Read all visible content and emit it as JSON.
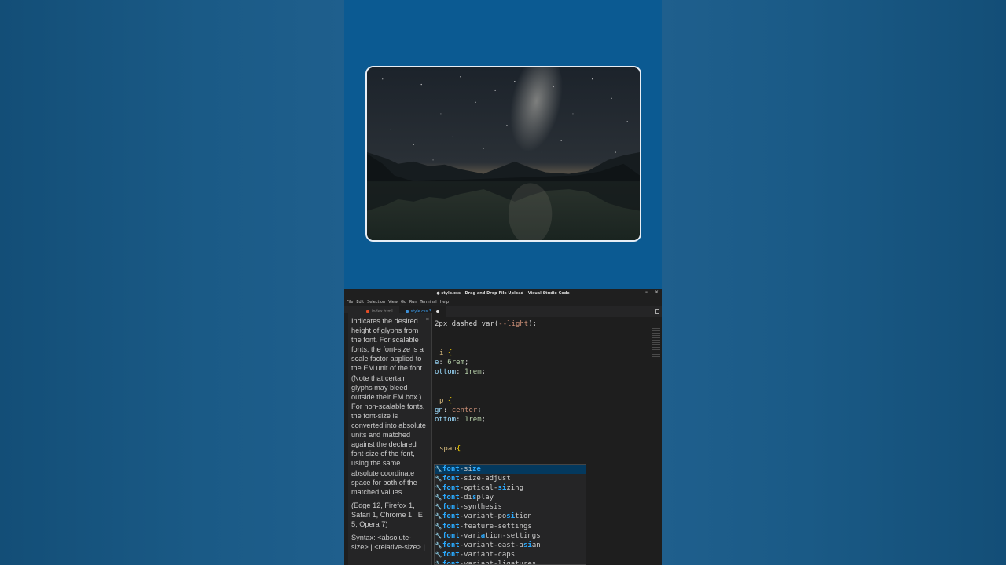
{
  "window": {
    "title": "● style.css - Drag and Drop File Upload - Visual Studio Code",
    "controls": [
      "–",
      "×"
    ]
  },
  "menu": [
    "File",
    "Edit",
    "Selection",
    "View",
    "Go",
    "Run",
    "Terminal",
    "Help"
  ],
  "tabs": [
    {
      "label": "index.html"
    },
    {
      "label": "style.css 3"
    }
  ],
  "code_lines": [
    {
      "pre": "2px dashed var(",
      "val": "--light",
      "post": ");"
    },
    {
      "sel": "i",
      "brace": " {"
    },
    {
      "prop": "e",
      "colon": ": ",
      "num": "6rem",
      "end": ";"
    },
    {
      "prop": "ottom",
      "colon": ": ",
      "num": "1rem",
      "end": ";"
    },
    {
      "sel": "p",
      "brace": " {"
    },
    {
      "prop": "gn",
      "colon": ": ",
      "num": "center",
      "end": ";"
    },
    {
      "prop": "ottom",
      "colon": ": ",
      "num": "1rem",
      "end": ";"
    },
    {
      "sel": "span",
      "brace": "{"
    }
  ],
  "hover_doc": {
    "description": "Indicates the desired height of glyphs from the font. For scalable fonts, the font-size is a scale factor applied to the EM unit of the font. (Note that certain glyphs may bleed outside their EM box.) For non-scalable fonts, the font-size is converted into absolute units and matched against the declared font-size of the font, using the same absolute coordinate space for both of the matched values.",
    "compat": "(Edge 12, Firefox 1, Safari 1, Chrome 1, IE 5, Opera 7)",
    "syntax": "Syntax: <absolute-size> | <relative-size> |"
  },
  "suggestions": [
    {
      "parts": [
        [
          "font",
          true
        ],
        [
          "-si",
          false
        ],
        [
          "ze",
          true
        ]
      ],
      "label": "font-size",
      "selected": true
    },
    {
      "parts": [
        [
          "font",
          true
        ],
        [
          "-size-adjust",
          false
        ]
      ],
      "label": "font-size-adjust"
    },
    {
      "parts": [
        [
          "font",
          true
        ],
        [
          "-optical-",
          false
        ],
        [
          "si",
          true
        ],
        [
          "zing",
          false
        ]
      ],
      "label": "font-optical-sizing"
    },
    {
      "parts": [
        [
          "font",
          true
        ],
        [
          "-di",
          false
        ],
        [
          "s",
          true
        ],
        [
          "play",
          false
        ]
      ],
      "label": "font-display"
    },
    {
      "parts": [
        [
          "font",
          true
        ],
        [
          "-synthesis",
          false
        ]
      ],
      "label": "font-synthesis"
    },
    {
      "parts": [
        [
          "font",
          true
        ],
        [
          "-variant-po",
          false
        ],
        [
          "si",
          true
        ],
        [
          "tion",
          false
        ]
      ],
      "label": "font-variant-position"
    },
    {
      "parts": [
        [
          "font",
          true
        ],
        [
          "-feature-settings",
          false
        ]
      ],
      "label": "font-feature-settings"
    },
    {
      "parts": [
        [
          "font",
          true
        ],
        [
          "-vari",
          false
        ],
        [
          "a",
          true
        ],
        [
          "tion-settings",
          false
        ]
      ],
      "label": "font-variation-settings"
    },
    {
      "parts": [
        [
          "font",
          true
        ],
        [
          "-variant-east-a",
          false
        ],
        [
          "si",
          true
        ],
        [
          "an",
          false
        ]
      ],
      "label": "font-variant-east-asian"
    },
    {
      "parts": [
        [
          "font",
          true
        ],
        [
          "-variant-caps",
          false
        ]
      ],
      "label": "font-variant-caps"
    },
    {
      "parts": [
        [
          "font",
          true
        ],
        [
          "-variant-ligatures",
          false
        ]
      ],
      "label": "font-variant-ligatures"
    }
  ],
  "colors": {
    "page_background": "#1f5f8d",
    "column_background": "#0b5a92",
    "editor_background": "#1e1e1e",
    "suggest_highlight": "#2aaaff"
  }
}
